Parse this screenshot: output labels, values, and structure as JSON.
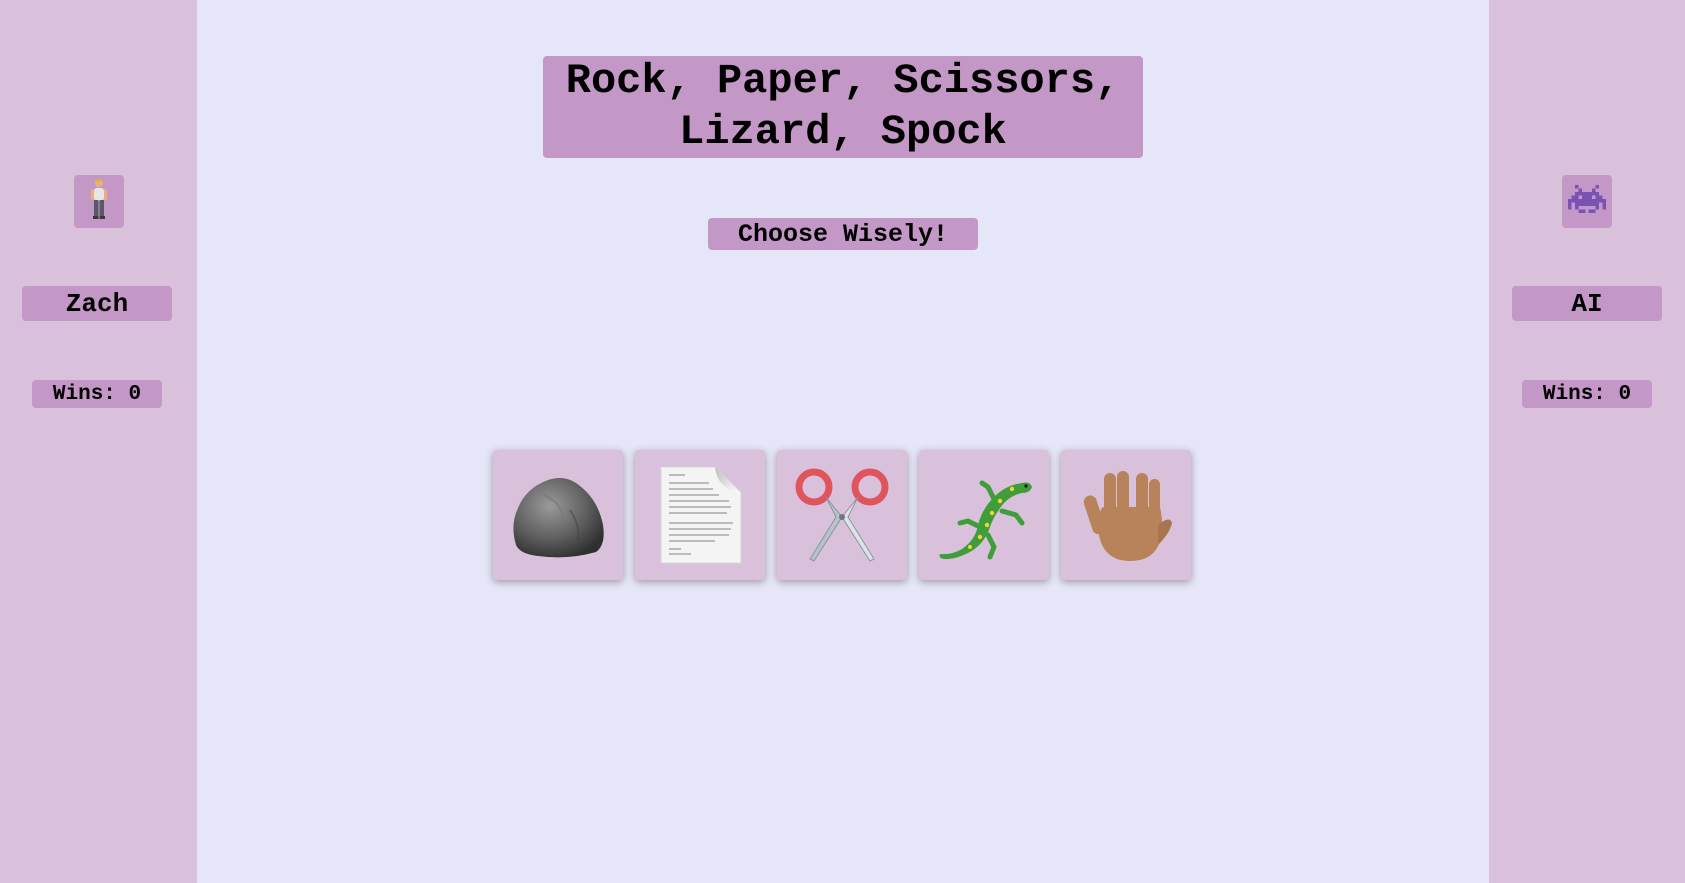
{
  "game": {
    "title": "Rock, Paper, Scissors, Lizard, Spock",
    "prompt": "Choose Wisely!"
  },
  "players": {
    "left": {
      "name": "Zach",
      "wins_label": "Wins: 0",
      "avatar_icon": "person-standing-icon"
    },
    "right": {
      "name": "AI",
      "wins_label": "Wins: 0",
      "avatar_icon": "space-invader-icon"
    }
  },
  "choices": [
    {
      "id": "rock",
      "icon": "rock-icon"
    },
    {
      "id": "paper",
      "icon": "paper-icon"
    },
    {
      "id": "scissors",
      "icon": "scissors-icon"
    },
    {
      "id": "lizard",
      "icon": "lizard-icon"
    },
    {
      "id": "spock",
      "icon": "vulcan-salute-icon"
    }
  ],
  "colors": {
    "background": "#e6e6f9",
    "panel": "#d9c1db",
    "label": "#c498c6"
  }
}
